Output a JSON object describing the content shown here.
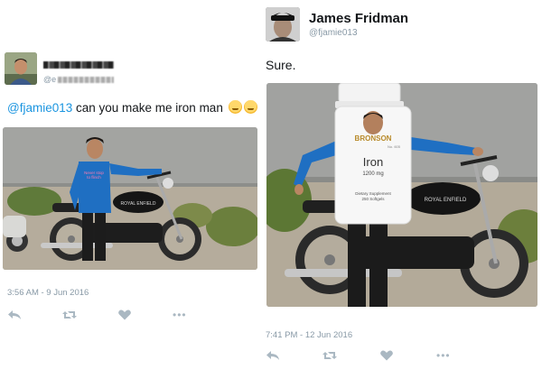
{
  "left_tweet": {
    "handle_prefix": "@e",
    "mention": "@fjamie013",
    "text": " can you make  me iron man",
    "timestamp": "3:56 AM - 9 Jun 2016",
    "shirt_text": "Never stop\nto flinch",
    "bike_tank_text": "ROYAL ENFIELD"
  },
  "right_tweet": {
    "name": "James Fridman",
    "handle": "@fjamie013",
    "text": "Sure.",
    "timestamp": "7:41 PM - 12 Jun 2016",
    "bottle": {
      "brand": "BRONSON",
      "count_label": "No. 605",
      "title": "Iron",
      "dose": "1200 mg",
      "desc_line1": "Dietary Supplement",
      "desc_line2": "250 Softgels"
    },
    "bike_tank_text": "ROYAL ENFIELD"
  },
  "actions": {
    "reply_icon": "reply-icon",
    "retweet_icon": "retweet-icon",
    "like_icon": "heart-icon",
    "more_icon": "more-icon",
    "more_glyph": "•••"
  },
  "colors": {
    "mention": "#1b95e0",
    "icon_gray": "#aab8c2",
    "meta_gray": "#8899a6",
    "shirt_blue": "#1f6fc2"
  }
}
